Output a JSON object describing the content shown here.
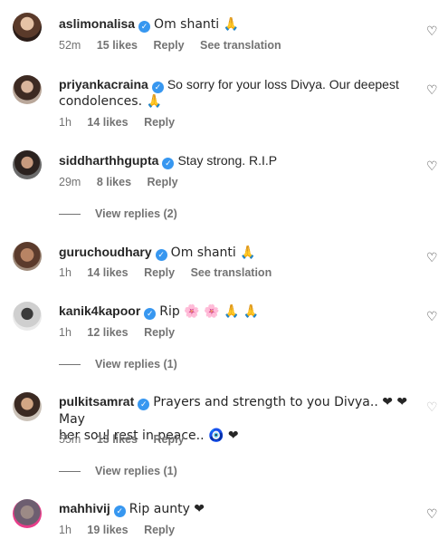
{
  "comments": [
    {
      "username": "aslimonalisa",
      "text": "Om shanti 🙏",
      "time": "52m",
      "likes": "15 likes",
      "reply": "Reply",
      "translate": "See translation"
    },
    {
      "username": "priyankacraina",
      "text": "So sorry for your loss Divya. Our deepest",
      "text2": "condolences. 🙏",
      "time": "1h",
      "likes": "14 likes",
      "reply": "Reply"
    },
    {
      "username": "siddharthhgupta",
      "text": "Stay strong. R.I.P",
      "time": "29m",
      "likes": "8 likes",
      "reply": "Reply",
      "view_replies": "View replies (2)"
    },
    {
      "username": "guruchoudhary",
      "text": "Om shanti 🙏",
      "time": "1h",
      "likes": "14 likes",
      "reply": "Reply",
      "translate": "See translation"
    },
    {
      "username": "kanik4kapoor",
      "text": "Rip 🌸 🌸 🙏 🙏",
      "time": "1h",
      "likes": "12 likes",
      "reply": "Reply",
      "view_replies": "View replies (1)"
    },
    {
      "username": "pulkitsamrat",
      "text": "Prayers and strength to you Divya.. ❤ ❤ May",
      "text2": "her soul rest in peace.. 🧿 ❤",
      "time": "55m",
      "likes": "13 likes",
      "reply": "Reply",
      "view_replies": "View replies (1)"
    },
    {
      "username": "mahhivij",
      "text": "Rip aunty ❤",
      "time": "1h",
      "likes": "19 likes",
      "reply": "Reply"
    }
  ]
}
